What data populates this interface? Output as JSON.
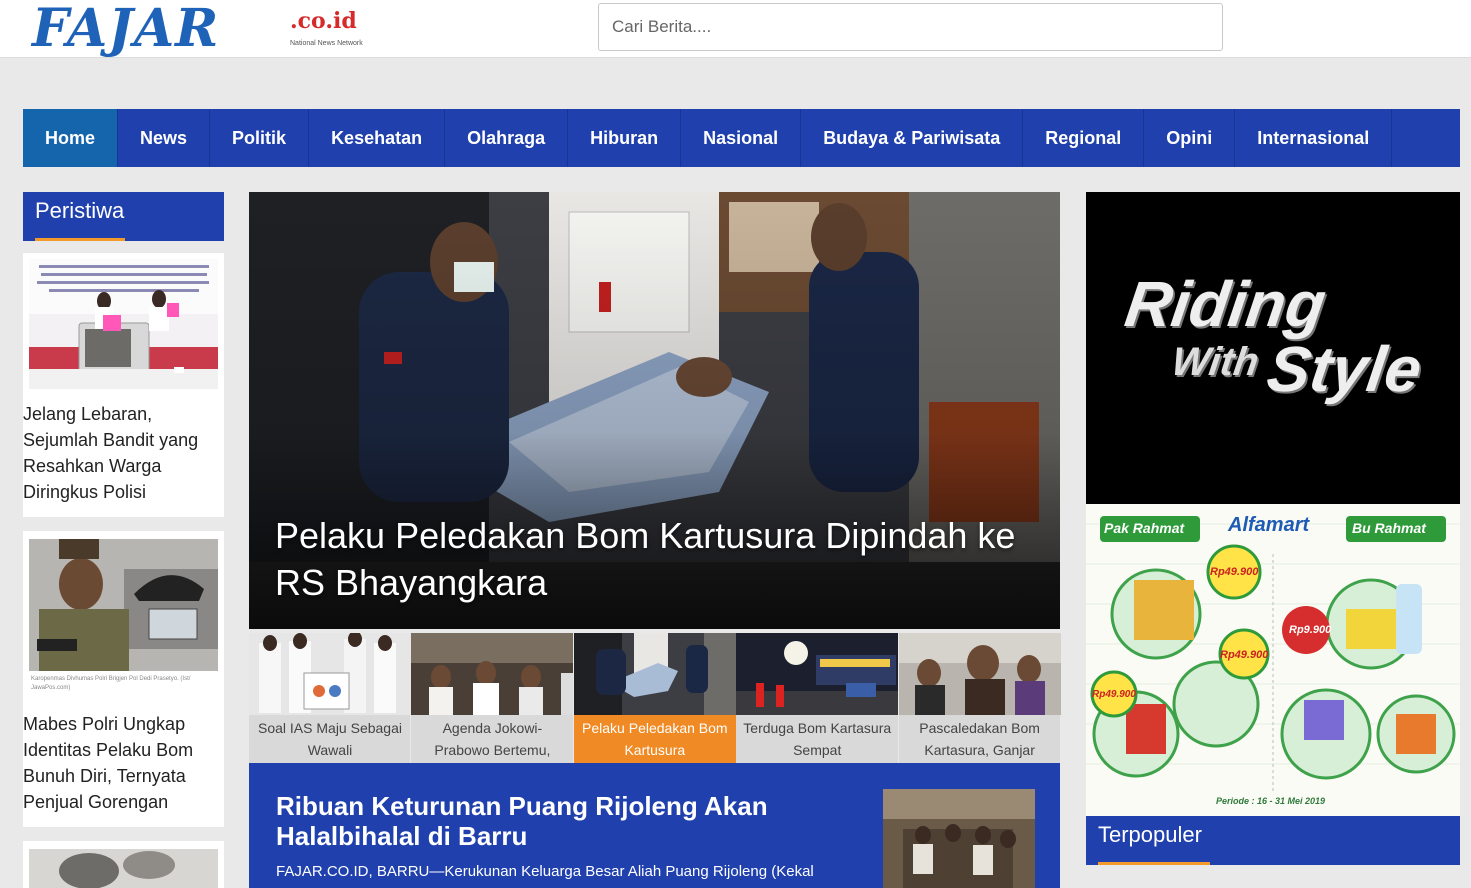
{
  "header": {
    "logo_main": "FAJAR",
    "logo_suffix": ".co.id",
    "logo_tagline": "National News Network",
    "search_placeholder": "Cari Berita...."
  },
  "nav": {
    "items": [
      "Home",
      "News",
      "Politik",
      "Kesehatan",
      "Olahraga",
      "Hiburan",
      "Nasional",
      "Budaya & Pariwisata",
      "Regional",
      "Opini",
      "Internasional"
    ],
    "active": "Home"
  },
  "sidebar": {
    "title": "Peristiwa",
    "articles": [
      {
        "title": "Jelang Lebaran, Sejumlah Bandit yang Resahkan Warga Diringkus Polisi"
      },
      {
        "title": "Mabes Polri Ungkap Identitas Pelaku Bom Bunuh Diri, Ternyata Penjual Gorengan",
        "caption": "Karopenmas Divhumas Polri Brigjen Pol Dedi Prasetyo. (Ist/ JawaPos.com)"
      },
      {
        "title": ""
      }
    ]
  },
  "hero": {
    "title": "Pelaku Peledakan Bom Kartusura Dipindah ke RS Bhayangkara"
  },
  "thumbs": [
    {
      "caption": "Soal IAS Maju Sebagai Wawali"
    },
    {
      "caption": "Agenda Jokowi-Prabowo Bertemu,"
    },
    {
      "caption": "Pelaku Peledakan Bom Kartusura",
      "active": true
    },
    {
      "caption": "Terduga Bom Kartasura Sempat"
    },
    {
      "caption": "Pascaledakan Bom Kartasura, Ganjar"
    }
  ],
  "feature": {
    "title": "Ribuan Keturunan Puang Rijoleng Akan Halalbihalal di Barru",
    "excerpt": "FAJAR.CO.ID, BARRU—Kerukunan Keluarga Besar Aliah Puang Rijoleng (Kekal"
  },
  "right": {
    "ad1_text": [
      "Riding",
      "With",
      "Style"
    ],
    "ad2": {
      "brand_left": "Pak Rahmat",
      "brand_center": "Alfamart",
      "brand_right": "Bu Rahmat",
      "prices": [
        "Rp49.900",
        "Rp9.900",
        "Rp49.900",
        "Rp49.900"
      ],
      "period": "Periode : 16 - 31 Mei 2019"
    },
    "popular_title": "Terpopuler"
  },
  "colors": {
    "brand_blue": "#1f40ad",
    "accent_orange": "#f08a24",
    "logo_blue": "#1f63b8"
  }
}
